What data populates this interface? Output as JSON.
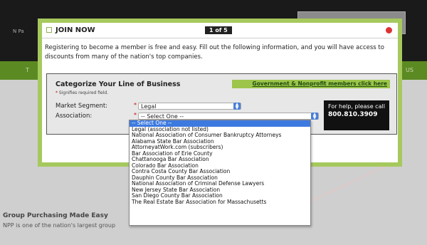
{
  "background": {
    "left_text": "N Pa",
    "nav_left": "T",
    "nav_right": "US",
    "heading": "Group Purchasing Made Easy",
    "subtext": "NPP is one of the nation's largest group"
  },
  "modal": {
    "title": "JOIN NOW",
    "step": "1 of 5",
    "intro": "Registering to become a member is free and easy. Fill out the following information, and you will have access to discounts from many of the nation's top companies.",
    "section_title": "Categorize Your Line of Business",
    "required_note": "Signifies required field.",
    "gov_link": "Government & Nonprofit members click here",
    "market_segment_label": "Market Segment:",
    "market_segment_value": "Legal",
    "association_label": "Association:",
    "association_value": "-- Select One --",
    "help_text": "For help, please call",
    "help_phone": "800.810.3909"
  },
  "dropdown": {
    "options": [
      "-- Select One --",
      "Legal (association not listed)",
      "National Association of Consumer Bankruptcy Attorneys",
      "Alabama State Bar Association",
      "AttorneyatWork.com (subscribers)",
      "Bar Association of Erie County",
      "Chattanooga Bar Association",
      "Colorado Bar Association",
      "Contra Costa County Bar Association",
      "Dauphin County Bar Association",
      "National Association of Criminal Defense Lawyers",
      "New Jersey State Bar Association",
      "San Diego County Bar Association",
      "The Real Estate Bar Association for Massachusetts"
    ]
  }
}
